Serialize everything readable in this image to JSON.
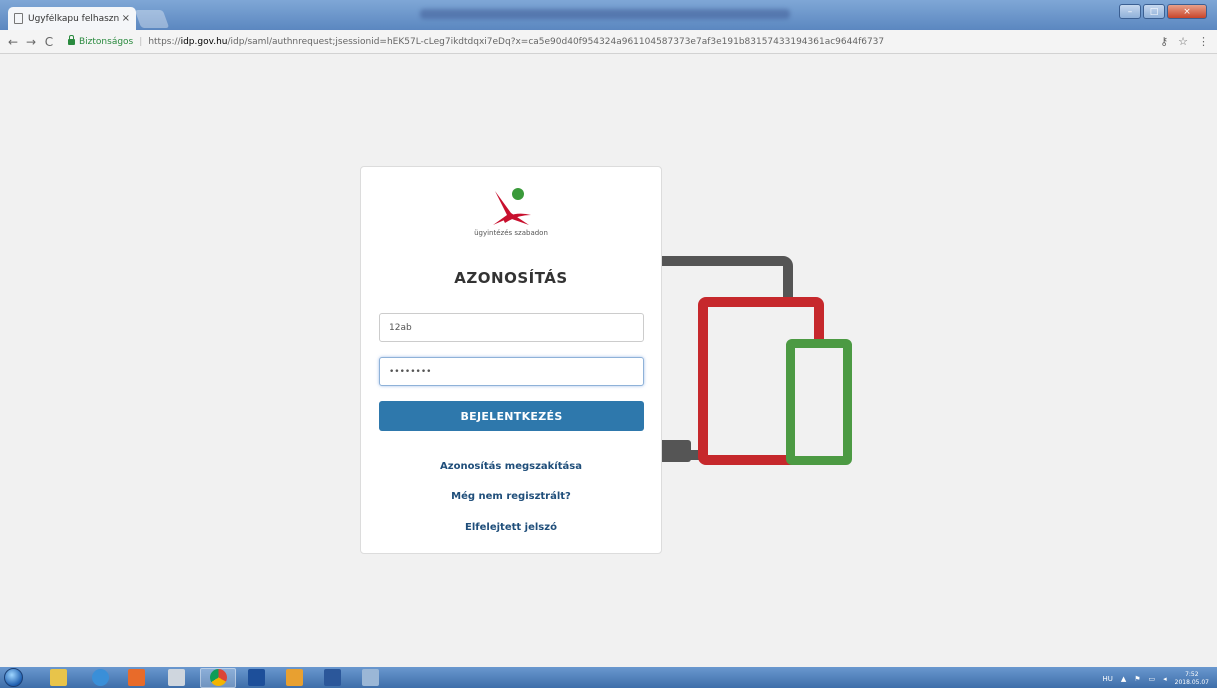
{
  "browser": {
    "tab_title": "Ügyfélkapu felhasználó",
    "tab_close": "×",
    "secure_label": "Biztonságos",
    "url_prefix": "https://",
    "url_host": "idp.gov.hu",
    "url_rest": "/idp/saml/authnrequest;jsessionid=hEK57L-cLeg7ikdtdqxi7eDq?x=ca5e90d40f954324a961104587373e7af3e191b83157433194361ac9644f6737",
    "key_icon": "key-icon",
    "star_icon": "star-icon",
    "menu_icon": "menu-dots-icon"
  },
  "login": {
    "tagline": "ügyintézés szabadon",
    "heading": "AZONOSÍTÁS",
    "username_value": "12ab",
    "password_value": "••••••••",
    "submit_label": "BEJELENTKEZÉS",
    "links": {
      "cancel": "Azonosítás megszakítása",
      "register": "Még nem regisztrált?",
      "forgot": "Elfelejtett jelszó"
    }
  },
  "taskbar": {
    "language": "HU",
    "time": "7:52",
    "date": "2018.05.07"
  },
  "colors": {
    "primary_button": "#2e78ac",
    "link": "#1f4e7a",
    "tablet": "#c6282c",
    "phone": "#4c9a43",
    "laptop": "#555555"
  }
}
